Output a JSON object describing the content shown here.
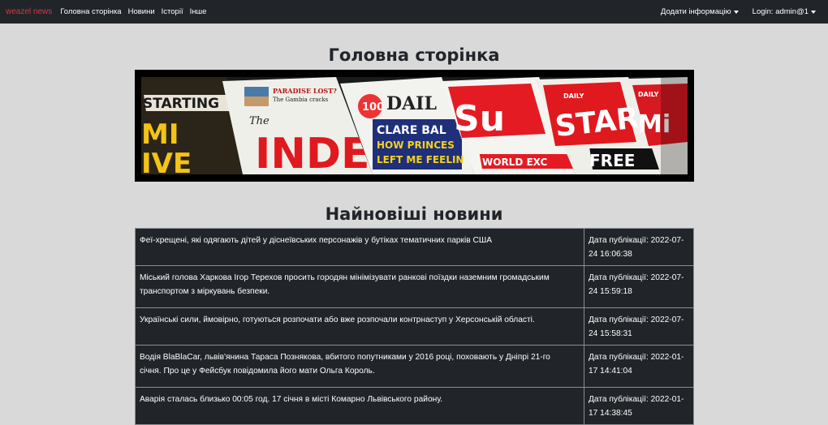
{
  "navbar": {
    "brand": "weazel news",
    "links": [
      "Головна сторінка",
      "Новини",
      "Історії",
      "Інше"
    ],
    "add_info": "Додати інформацію",
    "login": "Login: admin@1"
  },
  "page_title": "Головна сторінка",
  "banner": {
    "headlines": [
      "STARTING",
      "MI",
      "IVE",
      "PARADISE LOST?",
      "The Gambia cracks",
      "The",
      "INDE",
      "100",
      "DAIL",
      "CLARE BAL",
      "HOW PRINCES",
      "LEFT ME FEELIN",
      "Su",
      "WORLD EXC",
      "DAILY",
      "STAR",
      "FREE",
      "DAILY",
      "Mi"
    ]
  },
  "latest_title": "Найновіші новини",
  "news": [
    {
      "title": "Феї-хрещені, які одягають дітей у діснеївських персонажів у бутіках тематичних парків США",
      "date_line1": "Дата публікації: 2022-07-",
      "date_line2": "24 16:06:38"
    },
    {
      "title_line1": "Міський голова Харкова Ігор Терехов просить городян мінімізувати ранкові поїздки наземним громадським",
      "title_line2": "транспортом з міркувань безпеки.",
      "date_line1": "Дата публікації: 2022-07-",
      "date_line2": "24 15:59:18"
    },
    {
      "title": "Українські сили, ймовірно, готуються розпочати або вже розпочали контрнаступ у Херсонській області.",
      "date_line1": "Дата публікації: 2022-07-",
      "date_line2": "24 15:58:31"
    },
    {
      "title_line1": "Водія BlaBlaCar, львів'янина Тараса Познякова, вбитого попутниками у 2016 році, поховають у Дніпрі 21-го",
      "title_line2": "січня. Про це у Фейсбук повідомила його мати Ольга Король.",
      "date_line1": "Дата публікації: 2022-01-",
      "date_line2": "17 14:41:04"
    },
    {
      "title": "Аварія сталась близько 00:05 год. 17 січня в місті Комарно Львівського району.",
      "date_line1": "Дата публікації: 2022-01-",
      "date_line2": "17 14:38:45"
    }
  ],
  "colors": {
    "navbar_bg": "#212529",
    "brand": "#dc3545",
    "page_bg": "#d9d9d9",
    "table_bg": "#212529"
  }
}
